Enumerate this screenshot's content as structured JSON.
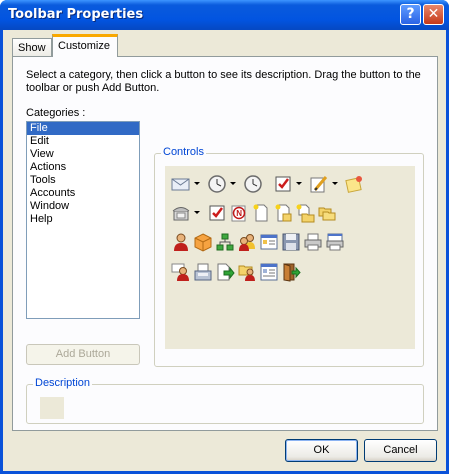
{
  "window": {
    "title": "Toolbar Properties",
    "help_glyph": "?",
    "close_glyph": "✕"
  },
  "tabs": [
    {
      "label": "Show"
    },
    {
      "label": "Customize"
    }
  ],
  "instructions": "Select a category, then click a button to see its description. Drag the button to the toolbar or push Add Button.",
  "categories": {
    "label": "Categories :",
    "items": [
      "File",
      "Edit",
      "View",
      "Actions",
      "Tools",
      "Accounts",
      "Window",
      "Help"
    ],
    "selected": "File"
  },
  "add_button": {
    "label": "Add Button",
    "enabled": false
  },
  "controls": {
    "label": "Controls",
    "rows": [
      [
        "envelope-dropdown",
        "clock-dropdown",
        "clock",
        "task-check-dropdown",
        "pencil-note-dropdown",
        "note-pin"
      ],
      [
        "phone-dropdown",
        "task-check",
        "no-entry-note",
        "new-doc",
        "new-doc-star",
        "new-doc-folder",
        "folders"
      ],
      [
        "user",
        "package",
        "org-chart",
        "users",
        "form-card",
        "floppy-save",
        "printer",
        "printer-preview"
      ],
      [
        "user-card",
        "fax",
        "doc-arrow",
        "folder-user",
        "document-view",
        "door-exit"
      ]
    ]
  },
  "description": {
    "label": "Description"
  },
  "footer": {
    "ok_label": "OK",
    "cancel_label": "Cancel"
  },
  "colors": {
    "title_bar": "#0254e0",
    "selection": "#316ac5",
    "group_label": "#0046d5",
    "dialog_face": "#ece9d8"
  }
}
